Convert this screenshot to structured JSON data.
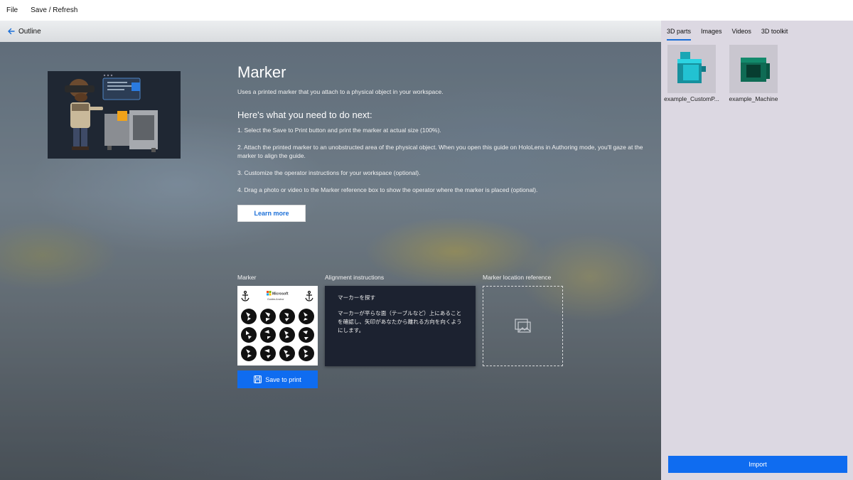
{
  "menubar": {
    "file": "File",
    "save_refresh": "Save / Refresh"
  },
  "outline": {
    "label": "Outline"
  },
  "main": {
    "title": "Marker",
    "subtitle": "Uses a printed marker that you attach to a physical object in your workspace.",
    "next_heading": "Here's what you need to do next:",
    "steps": [
      "1. Select the Save to Print button and print the marker at actual size (100%).",
      "2. Attach the printed marker to an unobstructed area of the physical object. When you open this guide on HoloLens in Authoring mode, you'll gaze at the marker to align the guide.",
      "3. Customize the operator instructions for your workspace (optional).",
      "4. Drag a photo or video to the Marker reference box to show the operator where the marker is placed (optional)."
    ],
    "learn_more": "Learn more",
    "marker_label": "Marker",
    "marker_brand": "Microsoft",
    "marker_caption": "Guides Anchor",
    "save_to_print": "Save to print",
    "alignment_label": "Alignment instructions",
    "alignment_title": "マーカーを探す",
    "alignment_body": "マーカーが平らな面（テーブルなど）上にあることを確認し、矢印があなたから離れる方向を向くようにします。",
    "location_label": "Marker location reference"
  },
  "panel": {
    "tabs": [
      "3D parts",
      "Images",
      "Videos",
      "3D toolkit"
    ],
    "active_tab": "3D parts",
    "parts": [
      {
        "name": "example_CustomP...",
        "color": "#1aa6b4"
      },
      {
        "name": "example_Machine",
        "color": "#0f6b54"
      }
    ],
    "import": "Import"
  },
  "colors": {
    "accent": "#0f6cf0",
    "panel_bg": "#dcd8e2"
  }
}
